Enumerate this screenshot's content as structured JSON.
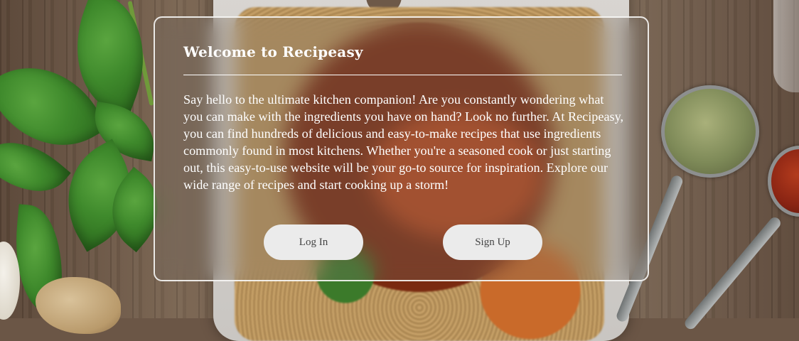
{
  "welcome_card": {
    "title": "Welcome to Recipeasy",
    "body": "Say hello to the ultimate kitchen companion! Are you constantly wondering what you can make with the ingredients you have on hand? Look no further. At Recipeasy, you can find hundreds of delicious and easy-to-make recipes that use ingredients commonly found in most kitchens. Whether you're a seasoned cook or just starting out, this easy-to-use website will be your go-to source for inspiration. Explore our wide range of recipes and start cooking up a storm!",
    "login_label": "Log In",
    "signup_label": "Sign Up"
  },
  "colors": {
    "card_border": "#ffffff",
    "button_bg": "#ebebeb",
    "button_text": "#444444",
    "text": "#ffffff"
  }
}
